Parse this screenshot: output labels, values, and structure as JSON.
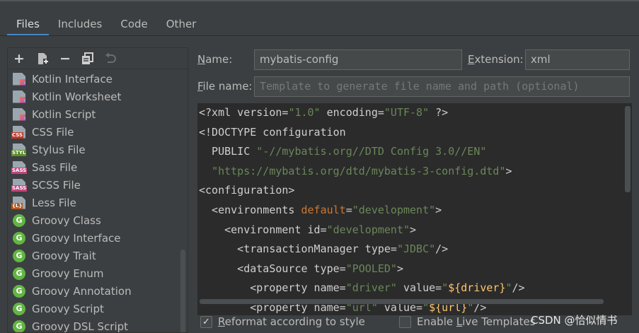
{
  "tabs": [
    {
      "label": "Files",
      "active": true
    },
    {
      "label": "Includes",
      "active": false
    },
    {
      "label": "Code",
      "active": false
    },
    {
      "label": "Other",
      "active": false
    }
  ],
  "toolbar": {
    "add": "+",
    "remove": "−"
  },
  "templates": [
    {
      "label": "Kotlin Interface",
      "icon": "kotlin-file-icon"
    },
    {
      "label": "Kotlin Worksheet",
      "icon": "kotlin-file-icon"
    },
    {
      "label": "Kotlin Script",
      "icon": "kotlin-file-icon"
    },
    {
      "label": "CSS File",
      "icon": "css-file-icon",
      "tag": "CSS",
      "tag_color": "#c0392b"
    },
    {
      "label": "Stylus File",
      "icon": "stylus-file-icon",
      "tag": "STYL",
      "tag_color": "#5b8c2a"
    },
    {
      "label": "Sass File",
      "icon": "sass-file-icon",
      "tag": "SASS",
      "tag_color": "#c0457a"
    },
    {
      "label": "SCSS File",
      "icon": "scss-file-icon",
      "tag": "SASS",
      "tag_color": "#c0457a"
    },
    {
      "label": "Less File",
      "icon": "less-file-icon",
      "tag": "{L}",
      "tag_color": "#b35a1f"
    },
    {
      "label": "Groovy Class",
      "icon": "groovy-icon"
    },
    {
      "label": "Groovy Interface",
      "icon": "groovy-icon"
    },
    {
      "label": "Groovy Trait",
      "icon": "groovy-icon"
    },
    {
      "label": "Groovy Enum",
      "icon": "groovy-icon"
    },
    {
      "label": "Groovy Annotation",
      "icon": "groovy-icon"
    },
    {
      "label": "Groovy Script",
      "icon": "groovy-icon"
    },
    {
      "label": "Groovy DSL Script",
      "icon": "groovy-icon"
    }
  ],
  "groovy_letter": "G",
  "form": {
    "name_label_u": "N",
    "name_label_rest": "ame:",
    "name_value": "mybatis-config",
    "extension_label_u": "E",
    "extension_label_rest": "xtension:",
    "extension_value": "xml",
    "filename_label_u": "F",
    "filename_label_rest": "ile name:",
    "filename_placeholder": "Template to generate file name and path (optional)"
  },
  "code_lines": [
    "<?xml version=\"1.0\" encoding=\"UTF-8\" ?>",
    "<!DOCTYPE configuration",
    "  PUBLIC \"-//mybatis.org//DTD Config 3.0//EN\"",
    "  \"https://mybatis.org/dtd/mybatis-3-config.dtd\">",
    "<configuration>",
    "  <environments default=\"development\">",
    "    <environment id=\"development\">",
    "      <transactionManager type=\"JDBC\"/>",
    "      <dataSource type=\"POOLED\">",
    "        <property name=\"driver\" value=\"${driver}\"/>",
    "        <property name=\"url\" value=\"${url}\"/>"
  ],
  "options": {
    "reformat_label_u": "R",
    "reformat_label_rest": "eformat according to style",
    "reformat_checked": true,
    "live_templates_label_pre": "Enable ",
    "live_templates_label_u": "L",
    "live_templates_label_rest": "ive Templates",
    "live_templates_checked": false
  },
  "watermark": "CSDN @恰似情书"
}
